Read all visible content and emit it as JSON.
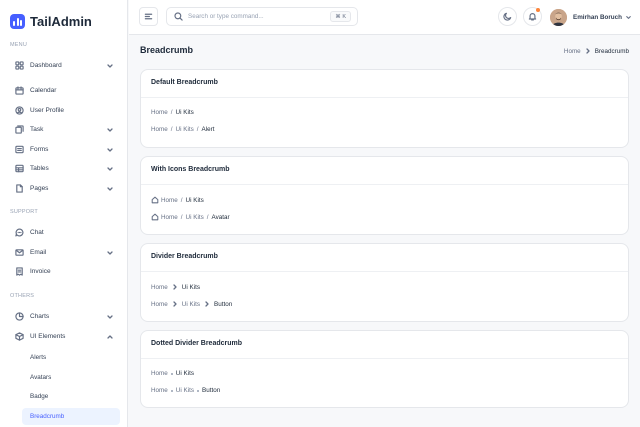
{
  "brand": {
    "name": "TailAdmin",
    "accent": "#465fff"
  },
  "sidebar": {
    "sections": [
      "MENU",
      "SUPPORT",
      "OTHERS"
    ],
    "menu": [
      {
        "label": "Dashboard",
        "icon": "grid-icon",
        "chevron": true
      },
      {
        "label": "Calendar",
        "icon": "calendar-icon",
        "chevron": false
      },
      {
        "label": "User Profile",
        "icon": "user-circle-icon",
        "chevron": false
      },
      {
        "label": "Task",
        "icon": "task-icon",
        "chevron": true
      },
      {
        "label": "Forms",
        "icon": "forms-icon",
        "chevron": true
      },
      {
        "label": "Tables",
        "icon": "table-icon",
        "chevron": true
      },
      {
        "label": "Pages",
        "icon": "pages-icon",
        "chevron": true
      }
    ],
    "support": [
      {
        "label": "Chat",
        "icon": "chat-icon",
        "chevron": false
      },
      {
        "label": "Email",
        "icon": "mail-icon",
        "chevron": true
      },
      {
        "label": "Invoice",
        "icon": "invoice-icon",
        "chevron": false
      }
    ],
    "others": [
      {
        "label": "Charts",
        "icon": "pie-chart-icon",
        "chevron": true
      },
      {
        "label": "UI Elements",
        "icon": "box-icon",
        "chevron": true,
        "expanded": true
      }
    ],
    "ui_elements_sub": [
      "Alerts",
      "Avatars",
      "Badge",
      "Breadcrumb"
    ],
    "active_sub": "Breadcrumb"
  },
  "header": {
    "search_placeholder": "Search or type command...",
    "shortcut": "⌘ K",
    "user_name": "Emirhan Boruch"
  },
  "page": {
    "title": "Breadcrumb",
    "crumb_home": "Home",
    "crumb_current": "Breadcrumb"
  },
  "cards": [
    {
      "title": "Default Breadcrumb",
      "style": "slash",
      "rows": [
        [
          "Home",
          "Ui Kits"
        ],
        [
          "Home",
          "Ui Kits",
          "Alert"
        ]
      ]
    },
    {
      "title": "With Icons Breadcrumb",
      "style": "slash-icon",
      "rows": [
        [
          "Home",
          "Ui Kits"
        ],
        [
          "Home",
          "Ui Kits",
          "Avatar"
        ]
      ]
    },
    {
      "title": "Divider Breadcrumb",
      "style": "chevron",
      "rows": [
        [
          "Home",
          "Ui Kits"
        ],
        [
          "Home",
          "Ui Kits",
          "Button"
        ]
      ]
    },
    {
      "title": "Dotted Divider Breadcrumb",
      "style": "dot",
      "rows": [
        [
          "Home",
          "Ui Kits"
        ],
        [
          "Home",
          "Ui Kits",
          "Button"
        ]
      ]
    }
  ]
}
